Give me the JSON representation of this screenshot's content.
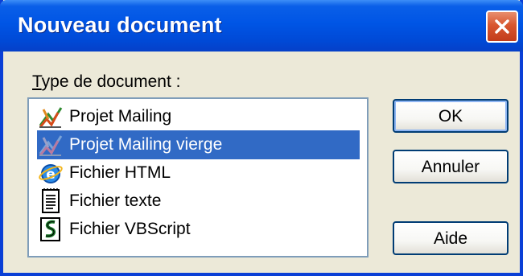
{
  "window": {
    "title": "Nouveau document",
    "title_color": "#ffffff",
    "titlebar_color": "#0055e5"
  },
  "type_label": {
    "mnemonic": "T",
    "rest": "ype de document :"
  },
  "document_types": [
    {
      "label": "Projet Mailing",
      "icon": "mailing-project-icon",
      "selected": false
    },
    {
      "label": "Projet Mailing vierge",
      "icon": "blank-mailing-project-icon",
      "selected": true
    },
    {
      "label": "Fichier HTML",
      "icon": "html-file-icon",
      "selected": false
    },
    {
      "label": "Fichier texte",
      "icon": "text-file-icon",
      "selected": false
    },
    {
      "label": "Fichier VBScript",
      "icon": "vbscript-file-icon",
      "selected": false
    }
  ],
  "buttons": {
    "ok": "OK",
    "cancel": "Annuler",
    "help": "Aide"
  },
  "colors": {
    "selection": "#316ac5",
    "dialog_bg": "#ece9d8",
    "close_button": "#d8562f"
  }
}
